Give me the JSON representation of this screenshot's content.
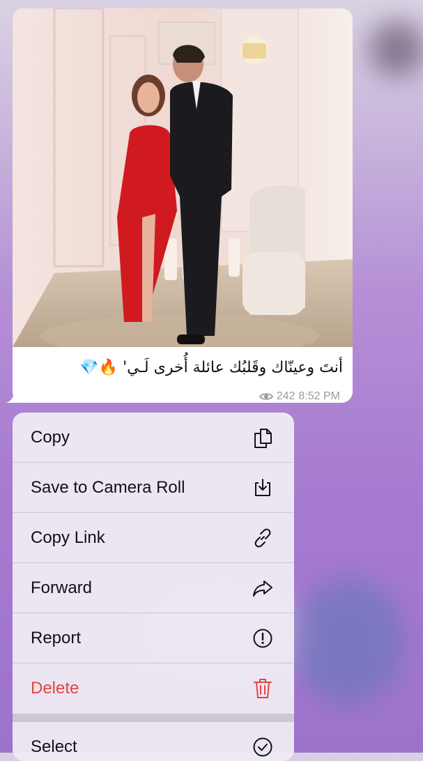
{
  "message": {
    "caption": "أنتَ وعينّاك وقَلبُك عائلة أُخرى لَـي' 🔥💎",
    "views": "242",
    "time": "8:52 PM"
  },
  "context_menu": {
    "items": [
      {
        "label": "Copy",
        "icon": "copy-icon"
      },
      {
        "label": "Save to Camera Roll",
        "icon": "save-download-icon"
      },
      {
        "label": "Copy Link",
        "icon": "link-icon"
      },
      {
        "label": "Forward",
        "icon": "forward-arrow-icon"
      },
      {
        "label": "Report",
        "icon": "exclamation-circle-icon"
      },
      {
        "label": "Delete",
        "icon": "trash-icon",
        "color": "#e0463e"
      },
      {
        "label": "Select",
        "icon": "checkmark-circle-icon"
      }
    ]
  }
}
